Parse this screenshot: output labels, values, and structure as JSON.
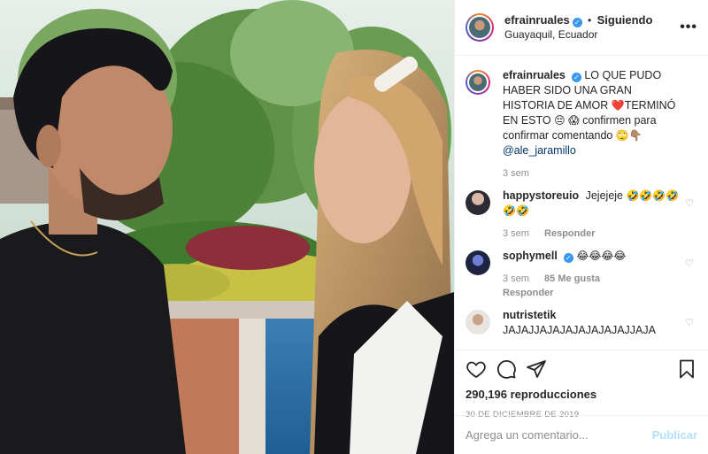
{
  "header": {
    "username": "efrainruales",
    "separator": "•",
    "follow_status": "Siguiendo",
    "location": "Guayaquil, Ecuador",
    "more_label": "•••"
  },
  "caption": {
    "username": "efrainruales",
    "text_1": "LO QUE PUDO HABER SIDO UNA GRAN HISTORIA DE AMOR",
    "emoji_heart": "❤️",
    "text_2": "TERMINÓ EN ESTO",
    "emoji_sad": "😔",
    "emoji_shock": "😱",
    "text_3": "confirmen para confirmar comentando",
    "emoji_roll": "🙄",
    "emoji_point": "👇🏽",
    "mention": "@ale_jaramillo",
    "time": "3 sem"
  },
  "comments": [
    {
      "username": "happystoreuio",
      "text": "Jejejeje",
      "emojis": "🤣🤣🤣🤣🤣🤣",
      "time": "3 sem",
      "reply": "Responder",
      "likes": ""
    },
    {
      "username": "sophymell",
      "text": "",
      "emojis": "😂😂😂😂",
      "time": "3 sem",
      "likes": "85 Me gusta",
      "reply": "Responder"
    },
    {
      "username": "nutristetik",
      "text": "JAJAJJAJAJAJAJAJAJAJJAJA",
      "emojis": "",
      "time": "",
      "reply": "",
      "likes": ""
    }
  ],
  "actions": {
    "views": "290,196 reproducciones",
    "date": "30 DE DICIEMBRE DE 2019",
    "comment_placeholder": "Agrega un comentario...",
    "post_label": "Publicar"
  },
  "icons": {
    "like": "heart-icon",
    "comment": "comment-icon",
    "share": "share-icon",
    "save": "bookmark-icon",
    "verified": "verified-badge-icon"
  },
  "colors": {
    "verified": "#3897f0",
    "muted": "#8e8e8e",
    "post_disabled": "#b2dffc",
    "mention": "#00376b"
  }
}
